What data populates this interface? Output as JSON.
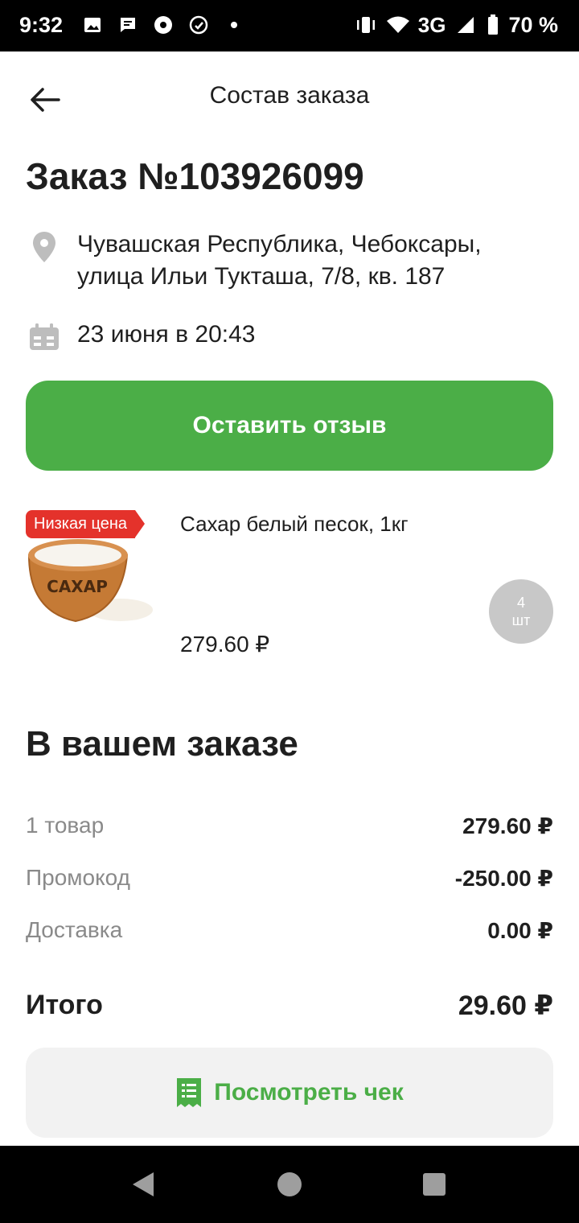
{
  "status_bar": {
    "time": "9:32",
    "network": "3G",
    "battery": "70 %"
  },
  "header": {
    "title": "Состав заказа"
  },
  "order": {
    "title": "Заказ №103926099",
    "address": "Чувашская Республика, Чебоксары, улица Ильи Тукташа, 7/8, кв. 187",
    "date": "23 июня в 20:43"
  },
  "review_button": "Оставить отзыв",
  "product": {
    "badge": "Низкая цена",
    "name": "Сахар белый песок, 1кг",
    "price": "279.60 ₽",
    "qty_number": "4",
    "qty_unit": "шт",
    "image_label": "САХАР"
  },
  "summary": {
    "title": "В вашем заказе",
    "rows": [
      {
        "label": "1 товар",
        "value": "279.60 ₽"
      },
      {
        "label": "Промокод",
        "value": "-250.00 ₽"
      },
      {
        "label": "Доставка",
        "value": "0.00 ₽"
      }
    ],
    "total_label": "Итого",
    "total_value": "29.60 ₽"
  },
  "receipt_button": "Посмотреть чек",
  "colors": {
    "accent": "#4bae47",
    "badge": "#e4322b"
  }
}
